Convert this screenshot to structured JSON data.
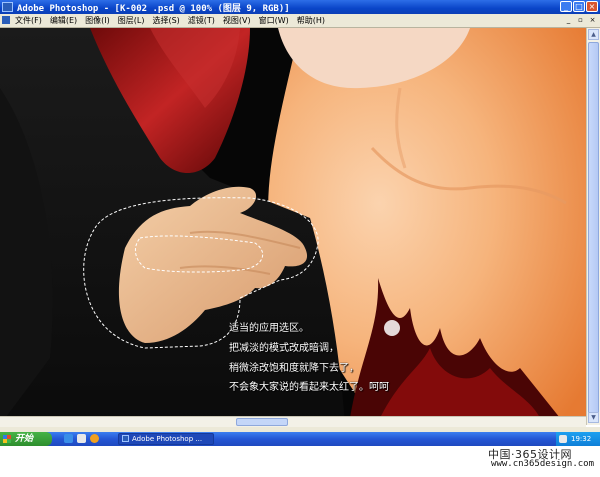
{
  "window": {
    "title": "Adobe Photoshop - [K-002 .psd @ 100% (图层 9, RGB)]",
    "controls": {
      "minimize": "_",
      "maximize": "□",
      "close": "×"
    }
  },
  "menubar": {
    "items": [
      "文件(F)",
      "编辑(E)",
      "图像(I)",
      "图层(L)",
      "选择(S)",
      "滤镜(T)",
      "视图(V)",
      "窗口(W)",
      "帮助(H)"
    ],
    "mdi_controls": {
      "minimize": "_",
      "restore": "▫",
      "close": "×"
    }
  },
  "canvas": {
    "annotation": [
      "适当的应用选区。",
      "把减淡的模式改成暗调，",
      "稍微涂改饱和度就降下去了，",
      "不会象大家说的看起来太红了。呵呵"
    ]
  },
  "taskbar": {
    "start_label": "开始",
    "task_label": "Adobe Photoshop ...",
    "clock": "19:32"
  },
  "watermark": {
    "line1": "中国·365设计网",
    "line2": "www.cn365design.com"
  },
  "colors": {
    "titlebar": "#0a45c8",
    "taskbar": "#2456d4",
    "start": "#2e8e2e",
    "chrome": "#ece9d8",
    "skin": "#f2a46a",
    "scarf": "#b52020"
  }
}
